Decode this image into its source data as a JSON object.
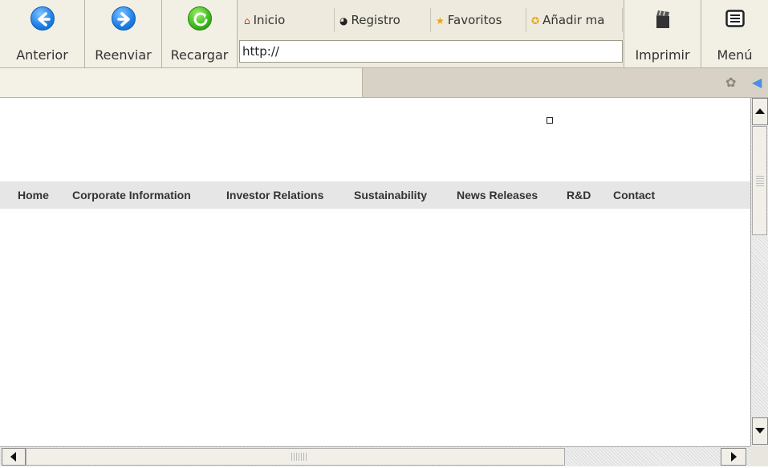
{
  "toolbar": {
    "back_label": "Anterior",
    "forward_label": "Reenviar",
    "reload_label": "Recargar",
    "print_label": "Imprimir",
    "menu_label": "Menú"
  },
  "bookmarks": [
    {
      "label": "Inicio",
      "icon": "home-icon"
    },
    {
      "label": "Registro",
      "icon": "history-icon"
    },
    {
      "label": "Favoritos",
      "icon": "star-icon"
    },
    {
      "label": "Añadir ma",
      "icon": "add-bookmark-icon"
    }
  ],
  "address_bar": {
    "value": "http://"
  },
  "page": {
    "nav": [
      "Home",
      "Corporate Information",
      "Investor Relations",
      "Sustainability",
      "News Releases",
      "R&D",
      "Contact"
    ]
  },
  "colors": {
    "toolbar_bg": "#eeeade",
    "nav_bg": "#e6e6e6",
    "nav_text": "#333333"
  }
}
